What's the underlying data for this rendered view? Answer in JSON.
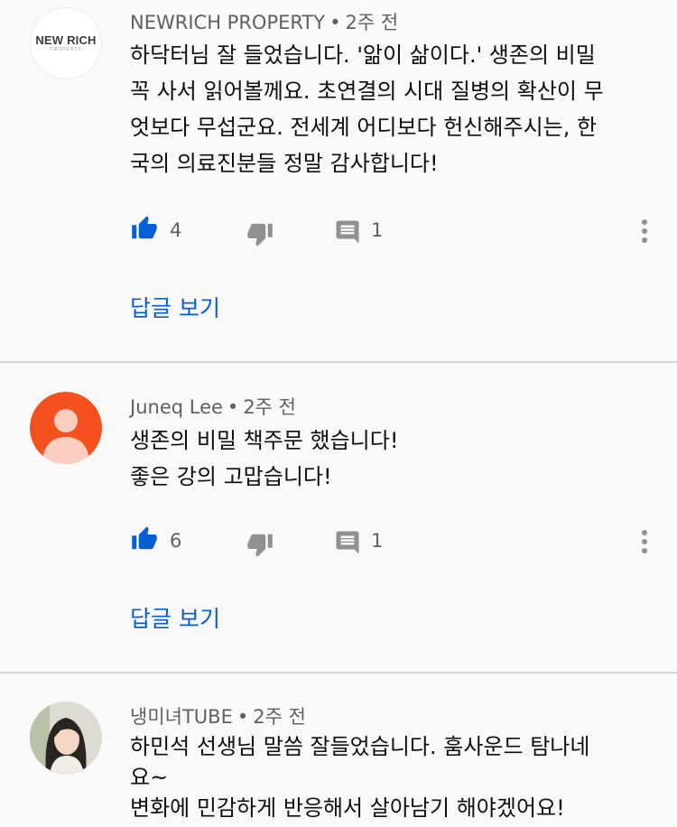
{
  "comments": [
    {
      "avatar": {
        "type": "logo",
        "logo_text": "NEW RICH",
        "logo_subtext": "PROPERTY"
      },
      "author": "NEWRICH PROPERTY",
      "separator": "•",
      "time": "2주 전",
      "text": "하닥터님 잘 들었습니다. '앎이 삶이다.' 생존의 비밀\n꼭 사서 읽어볼께요. 초연결의 시대 질병의 확산이 무\n엇보다 무섭군요. 전세계 어디보다 헌신해주시는, 한\n국의 의료진분들 정말 감사합니다!",
      "likes": "4",
      "reply_count": "1",
      "view_replies": "답글 보기"
    },
    {
      "avatar": {
        "type": "default",
        "color": "#f4511e"
      },
      "author": "Juneq Lee",
      "separator": "•",
      "time": "2주 전",
      "text": "생존의 비밀 책주문 했습니다!\n좋은 강의 고맙습니다!",
      "likes": "6",
      "reply_count": "1",
      "view_replies": "답글 보기"
    },
    {
      "avatar": {
        "type": "photo"
      },
      "author": "냉미녀TUBE",
      "separator": "•",
      "time": "2주 전",
      "text": "하민석 선생님 말씀 잘들었습니다. 훔사운드 탐나네\n요~\n변화에 민감하게 반응해서 살아남기 해야겠어요!"
    }
  ],
  "icons": {
    "like": "thumbs-up-icon",
    "dislike": "thumbs-down-icon",
    "reply": "comment-icon",
    "more": "more-vert-icon"
  },
  "colors": {
    "like_active": "#065fd4",
    "icon_gray": "#909090",
    "link_blue": "#065fd4",
    "background": "#f9f9f9",
    "divider": "#d6d6d6"
  }
}
